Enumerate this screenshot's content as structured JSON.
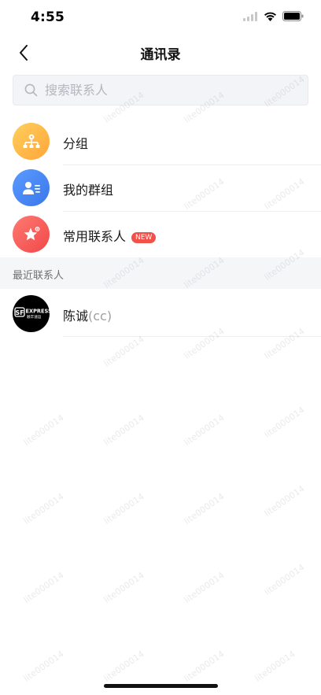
{
  "status_bar": {
    "time": "4:55"
  },
  "nav": {
    "title": "通讯录"
  },
  "search": {
    "placeholder": "搜索联系人"
  },
  "menu": [
    {
      "label": "分组",
      "icon": "org-chart-icon",
      "color": "#ffb545"
    },
    {
      "label": "我的群组",
      "icon": "group-card-icon",
      "color": "#4a8bf5"
    },
    {
      "label": "常用联系人",
      "icon": "star-icon",
      "color": "#f65a55"
    }
  ],
  "badge_new": "NEW",
  "section": {
    "recent": "最近联系人"
  },
  "contacts": [
    {
      "name": "陈诚",
      "alias": "(cc)",
      "avatar": {
        "icon": "sf-express-logo",
        "logo_text": "EXPRESS",
        "logo_sub": "顺丰速运",
        "logo_mark": "SF"
      }
    }
  ],
  "watermark": "lite000014",
  "colors": {
    "accent_orange": "#ffb545",
    "accent_blue": "#4a8bf5",
    "accent_red": "#f65a55",
    "badge_red": "#f0524a"
  }
}
